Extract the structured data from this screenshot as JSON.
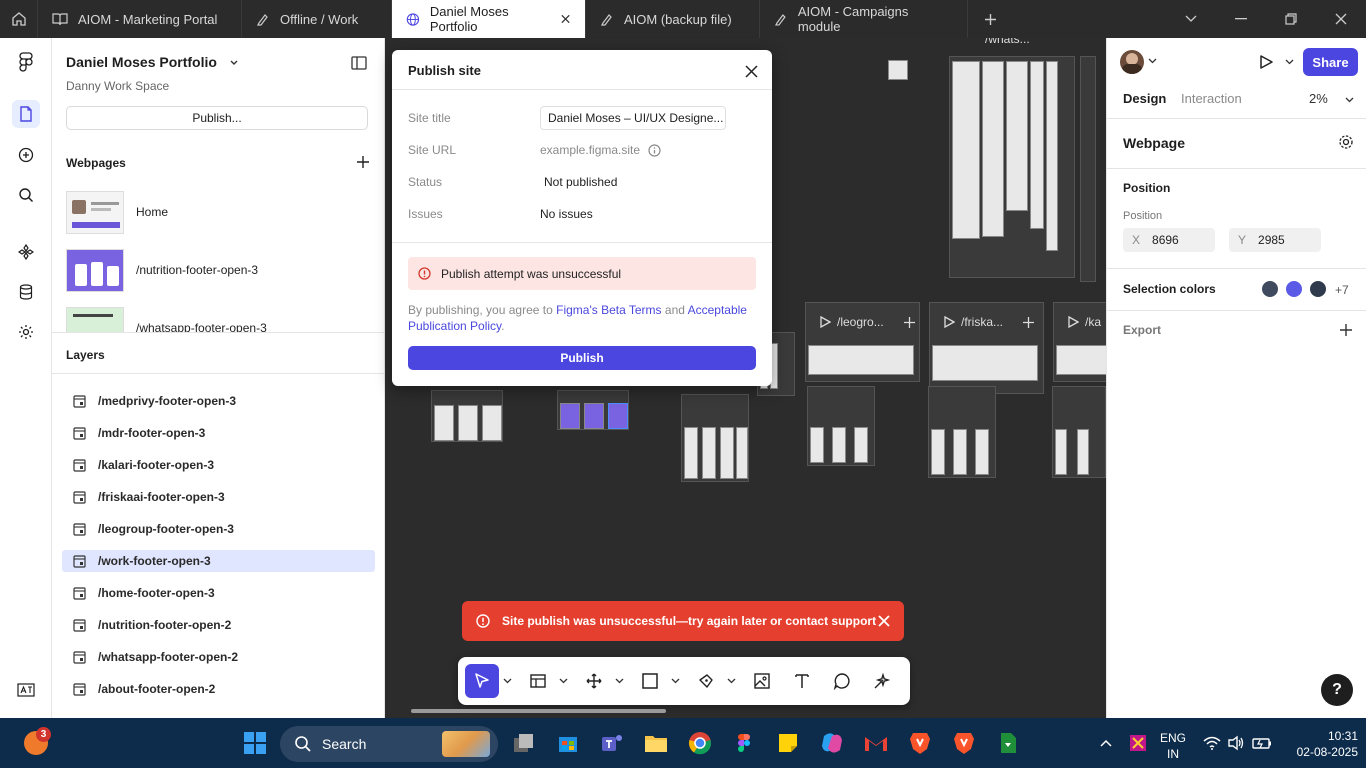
{
  "tabs": [
    {
      "label": "AIOM - Marketing Portal"
    },
    {
      "label": "Offline / Work"
    },
    {
      "label": "Daniel Moses Portfolio"
    },
    {
      "label": "AIOM (backup file)"
    },
    {
      "label": "AIOM - Campaigns module"
    }
  ],
  "left_panel": {
    "project_title": "Daniel Moses Portfolio",
    "workspace": "Danny Work Space",
    "publish_label": "Publish...",
    "webpages_title": "Webpages",
    "webpages": [
      {
        "label": "Home"
      },
      {
        "label": "/nutrition-footer-open-3"
      },
      {
        "label": "/whatsapp-footer-open-3"
      }
    ],
    "layers_title": "Layers",
    "layers": [
      {
        "label": "/medprivy-footer-open-3"
      },
      {
        "label": "/mdr-footer-open-3"
      },
      {
        "label": "/kalari-footer-open-3"
      },
      {
        "label": "/friskaai-footer-open-3"
      },
      {
        "label": "/leogroup-footer-open-3"
      },
      {
        "label": "/work-footer-open-3"
      },
      {
        "label": "/home-footer-open-3"
      },
      {
        "label": "/nutrition-footer-open-2"
      },
      {
        "label": "/whatsapp-footer-open-2"
      },
      {
        "label": "/about-footer-open-2"
      }
    ]
  },
  "canvas": {
    "frame_labels": [
      "/whats...",
      "/leogro...",
      "/friska...",
      "/ka"
    ]
  },
  "dialog": {
    "title": "Publish site",
    "site_title_label": "Site title",
    "site_title_value": "Daniel Moses – UI/UX Designe...",
    "site_url_label": "Site URL",
    "site_url_value": "example.figma.site",
    "status_label": "Status",
    "status_value": "Not published",
    "issues_label": "Issues",
    "issues_value": "No issues",
    "error_text": "Publish attempt was unsuccessful",
    "terms_prefix": "By publishing, you agree to",
    "terms_link1": "Figma's Beta Terms",
    "terms_and": "and",
    "terms_link2": "Acceptable Publication Policy",
    "terms_suffix": ".",
    "publish_button": "Publish"
  },
  "toast": {
    "text": "Site publish was unsuccessful—try again later or contact support"
  },
  "right_panel": {
    "share_label": "Share",
    "tab_design": "Design",
    "tab_interaction": "Interaction",
    "zoom": "2%",
    "webpage_title": "Webpage",
    "position_section": "Position",
    "position_sub": "Position",
    "x_label": "X",
    "x_value": "8696",
    "y_label": "Y",
    "y_value": "2985",
    "selection_colors_title": "Selection colors",
    "selection_colors": [
      "#3f4a5e",
      "#5a5ae6",
      "#2f3a4c"
    ],
    "selection_colors_more": "+7",
    "export_title": "Export"
  },
  "help_label": "?",
  "taskbar": {
    "search_label": "Search",
    "notification_count": "3",
    "lang_line1": "ENG",
    "lang_line2": "IN",
    "time": "10:31",
    "date": "02-08-2025"
  }
}
